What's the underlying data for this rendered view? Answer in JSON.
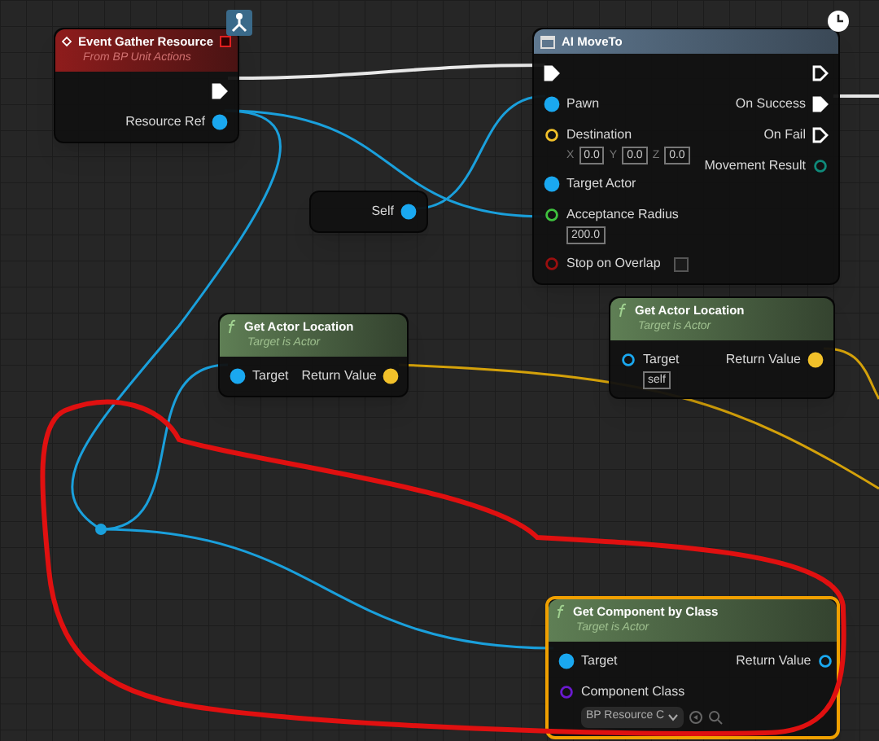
{
  "graph": {
    "nodes": [
      {
        "kind": "event",
        "title": "Event Gather Resource",
        "subtitle": "From BP Unit Actions",
        "selected": false,
        "outputs": [
          {
            "kind": "exec",
            "connected": true
          },
          {
            "kind": "object",
            "label": "Resource Ref",
            "connected": true
          }
        ]
      },
      {
        "kind": "latent",
        "title": "AI MoveTo",
        "selected": false,
        "inputs": [
          {
            "kind": "exec",
            "connected": true
          },
          {
            "kind": "object",
            "label": "Pawn",
            "connected": true
          },
          {
            "kind": "vector",
            "label": "Destination",
            "connected": false,
            "fields": [
              {
                "label": "X",
                "value": "0.0"
              },
              {
                "label": "Y",
                "value": "0.0"
              },
              {
                "label": "Z",
                "value": "0.0"
              }
            ]
          },
          {
            "kind": "object",
            "label": "Target Actor",
            "connected": true
          },
          {
            "kind": "float",
            "label": "Acceptance Radius",
            "connected": false,
            "fields": [
              {
                "value": "200.0"
              }
            ]
          },
          {
            "kind": "bool",
            "label": "Stop on Overlap",
            "connected": false,
            "checked": false
          }
        ],
        "outputs": [
          {
            "kind": "exec",
            "connected": false
          },
          {
            "kind": "exec",
            "label": "On Success",
            "connected": true
          },
          {
            "kind": "exec",
            "label": "On Fail",
            "connected": false
          },
          {
            "kind": "enum",
            "label": "Movement Result",
            "connected": false
          }
        ]
      },
      {
        "kind": "variable",
        "selected": false,
        "outputs": [
          {
            "kind": "object",
            "label": "Self",
            "connected": true
          }
        ]
      },
      {
        "kind": "function",
        "title": "Get Actor Location",
        "subtitle": "Target is Actor",
        "selected": false,
        "inputs": [
          {
            "kind": "object",
            "label": "Target",
            "connected": true
          }
        ],
        "outputs": [
          {
            "kind": "vector",
            "label": "Return Value",
            "connected": true
          }
        ]
      },
      {
        "kind": "function",
        "title": "Get Actor Location",
        "subtitle": "Target is Actor",
        "selected": false,
        "inputs": [
          {
            "kind": "object",
            "label": "Target",
            "connected": false,
            "fields": [
              {
                "value": "self"
              }
            ]
          }
        ],
        "outputs": [
          {
            "kind": "vector",
            "label": "Return Value",
            "connected": true
          }
        ]
      },
      {
        "kind": "function",
        "title": "Get Component by Class",
        "subtitle": "Target is Actor",
        "selected": true,
        "inputs": [
          {
            "kind": "object",
            "label": "Target",
            "connected": true
          },
          {
            "kind": "class",
            "label": "Component Class",
            "connected": false,
            "dropdown": "BP Resource C"
          }
        ],
        "outputs": [
          {
            "kind": "object",
            "label": "Return Value",
            "connected": false
          }
        ]
      }
    ]
  }
}
